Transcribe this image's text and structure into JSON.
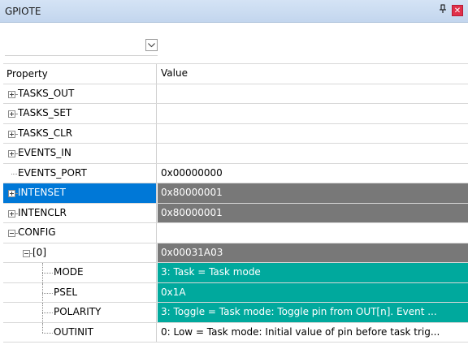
{
  "window": {
    "title": "GPIOTE",
    "pin_glyph": "↕",
    "close_glyph": "✕"
  },
  "columns": {
    "property": "Property",
    "value": "Value"
  },
  "rows": [
    {
      "name": "TASKS_OUT",
      "value": "",
      "expander": "plus",
      "depth": 0
    },
    {
      "name": "TASKS_SET",
      "value": "",
      "expander": "plus",
      "depth": 0
    },
    {
      "name": "TASKS_CLR",
      "value": "",
      "expander": "plus",
      "depth": 0
    },
    {
      "name": "EVENTS_IN",
      "value": "",
      "expander": "plus",
      "depth": 0
    },
    {
      "name": "EVENTS_PORT",
      "value": "0x00000000",
      "expander": "none",
      "depth": 0
    },
    {
      "name": "INTENSET",
      "value": "0x80000001",
      "expander": "plus",
      "depth": 0
    },
    {
      "name": "INTENCLR",
      "value": "0x80000001",
      "expander": "plus",
      "depth": 0
    },
    {
      "name": "CONFIG",
      "value": "",
      "expander": "minus",
      "depth": 0
    },
    {
      "name": "[0]",
      "value": "0x00031A03",
      "expander": "minus",
      "depth": 1
    },
    {
      "name": "MODE",
      "value": "3: Task = Task mode",
      "expander": "none",
      "depth": 2
    },
    {
      "name": "PSEL",
      "value": "0x1A",
      "expander": "none",
      "depth": 2
    },
    {
      "name": "POLARITY",
      "value": "3: Toggle = Task mode: Toggle pin from OUT[n]. Event ...",
      "expander": "none",
      "depth": 2
    },
    {
      "name": "OUTINIT",
      "value": "0: Low = Task mode: Initial value of pin before task trig...",
      "expander": "none",
      "depth": 2
    }
  ],
  "colors": {
    "selected": "#0078d7",
    "value_gray": "#787878",
    "value_teal": "#00a99d"
  }
}
